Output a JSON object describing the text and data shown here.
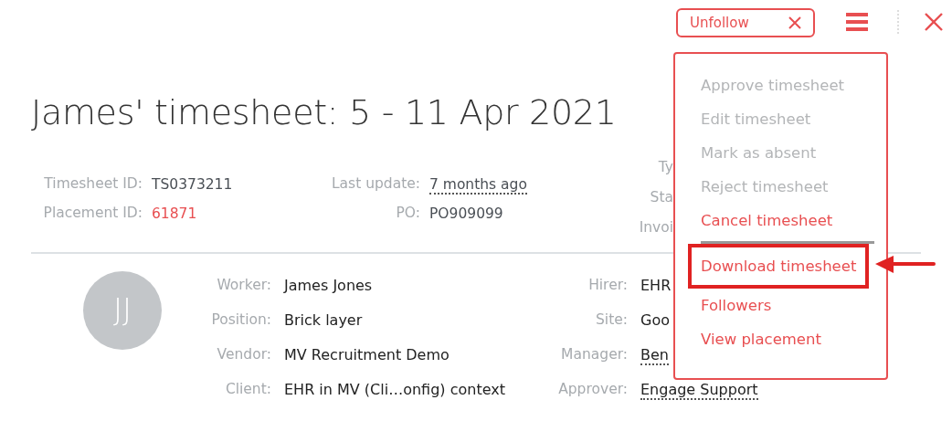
{
  "top_bar": {
    "unfollow_label": "Unfollow"
  },
  "title": "James' timesheet: 5 - 11 Apr 2021",
  "meta_left": [
    {
      "label": "Timesheet ID:",
      "value": "TS0373211",
      "kind": "text"
    },
    {
      "label": "Placement ID:",
      "value": "61871",
      "kind": "link"
    }
  ],
  "meta_middle": [
    {
      "label": "Last update:",
      "value": "7 months ago",
      "kind": "dotted"
    },
    {
      "label": "PO:",
      "value": "PO909099",
      "kind": "text"
    }
  ],
  "meta_right_labels": [
    "Ty",
    "Sta",
    "Invoi"
  ],
  "avatar": {
    "initials": "JJ"
  },
  "details_left": [
    {
      "label": "Worker:",
      "value": "James Jones",
      "kind": "text"
    },
    {
      "label": "Position:",
      "value": "Brick layer",
      "kind": "text"
    },
    {
      "label": "Vendor:",
      "value": "MV Recruitment Demo",
      "kind": "text"
    },
    {
      "label": "Client:",
      "value": "EHR in MV (Cli…onfig) context",
      "kind": "text"
    }
  ],
  "details_right": [
    {
      "label": "Hirer:",
      "value": "EHR",
      "kind": "text"
    },
    {
      "label": "Site:",
      "value": "Goo",
      "kind": "text"
    },
    {
      "label": "Manager:",
      "value": "Ben",
      "kind": "dotted"
    },
    {
      "label": "Approver:",
      "value": "Engage Support",
      "kind": "dotted"
    }
  ],
  "menu": {
    "items": [
      {
        "kind": "action",
        "label": "Approve timesheet",
        "disabled": true,
        "highlighted": false
      },
      {
        "kind": "action",
        "label": "Edit timesheet",
        "disabled": true,
        "highlighted": false
      },
      {
        "kind": "action",
        "label": "Mark as absent",
        "disabled": true,
        "highlighted": false
      },
      {
        "kind": "action",
        "label": "Reject timesheet",
        "disabled": true,
        "highlighted": false
      },
      {
        "kind": "action",
        "label": "Cancel timesheet",
        "disabled": false,
        "highlighted": false
      },
      {
        "kind": "separator"
      },
      {
        "kind": "action",
        "label": "Download timesheet",
        "disabled": false,
        "highlighted": true
      },
      {
        "kind": "action",
        "label": "Followers",
        "disabled": false,
        "highlighted": false
      },
      {
        "kind": "action",
        "label": "View placement",
        "disabled": false,
        "highlighted": false
      }
    ]
  }
}
